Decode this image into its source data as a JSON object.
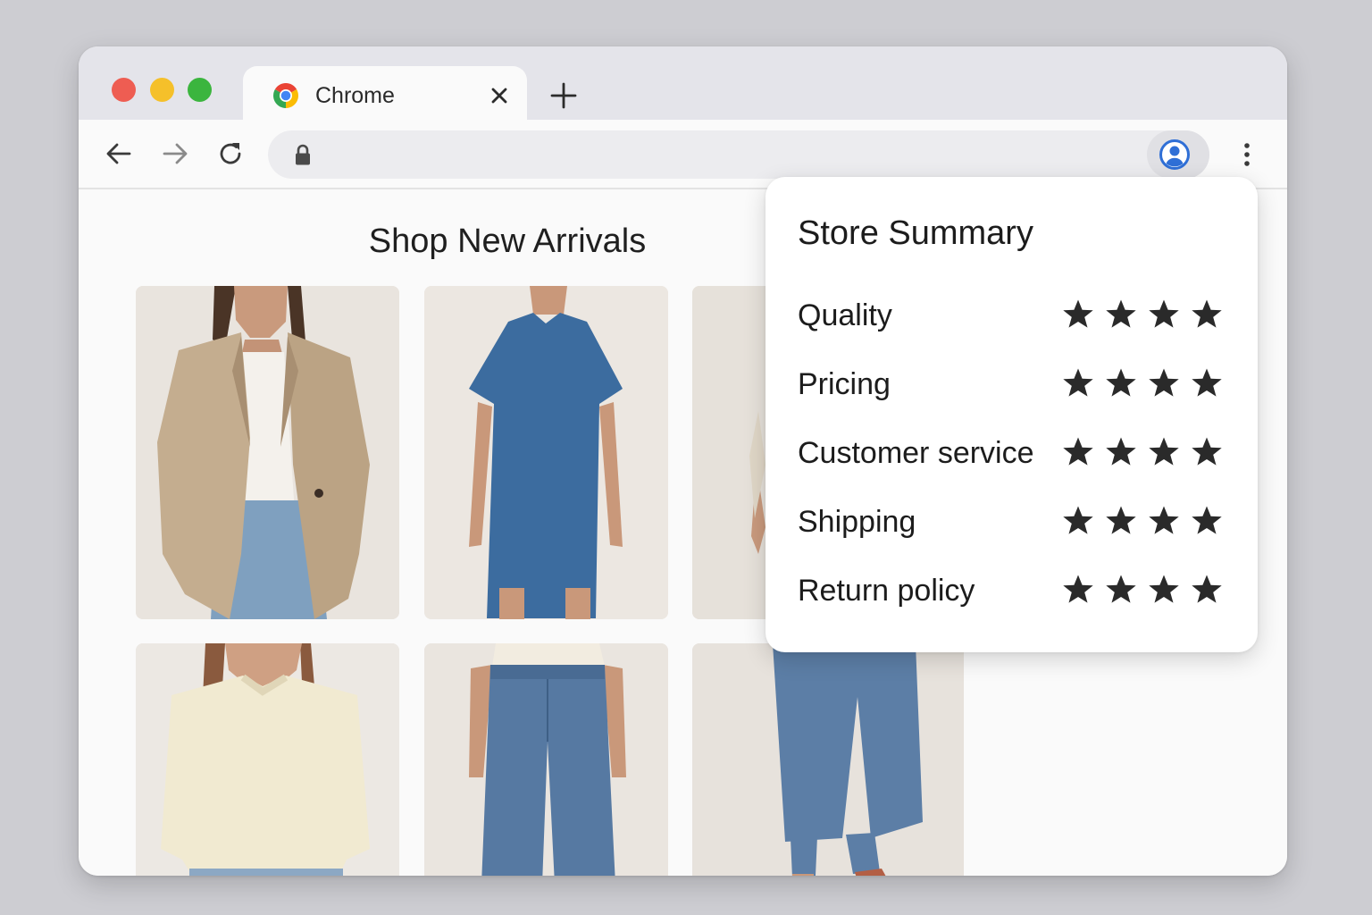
{
  "browser": {
    "tab": {
      "title": "Chrome",
      "icon": "chrome-logo-icon"
    },
    "new_tab_icon": "plus-icon",
    "close_icon": "close-icon",
    "toolbar": {
      "back_icon": "arrow-left-icon",
      "forward_icon": "arrow-right-icon",
      "reload_icon": "reload-icon",
      "address": {
        "value": "",
        "lock_icon": "lock-icon"
      },
      "profile_icon": "profile-icon",
      "menu_icon": "kebab-menu-icon"
    },
    "colors": {
      "traffic_red": "#ee5d52",
      "traffic_yellow": "#f5c02a",
      "traffic_green": "#3bb53e",
      "profile_blue": "#2f6fd6"
    }
  },
  "page": {
    "title": "Shop New Arrivals",
    "products": [
      {
        "name": "beige-blazer-with-jeans"
      },
      {
        "name": "blue-tshirt-dress"
      },
      {
        "name": "partially-hidden-item"
      },
      {
        "name": "cream-knit-sweater"
      },
      {
        "name": "high-waist-blue-jeans"
      },
      {
        "name": "straight-leg-jeans"
      }
    ]
  },
  "store_summary": {
    "title": "Store Summary",
    "ratings": [
      {
        "label": "Quality",
        "stars": 4
      },
      {
        "label": "Pricing",
        "stars": 4
      },
      {
        "label": "Customer service",
        "stars": 4
      },
      {
        "label": "Shipping",
        "stars": 4
      },
      {
        "label": "Return policy",
        "stars": 4
      }
    ]
  }
}
